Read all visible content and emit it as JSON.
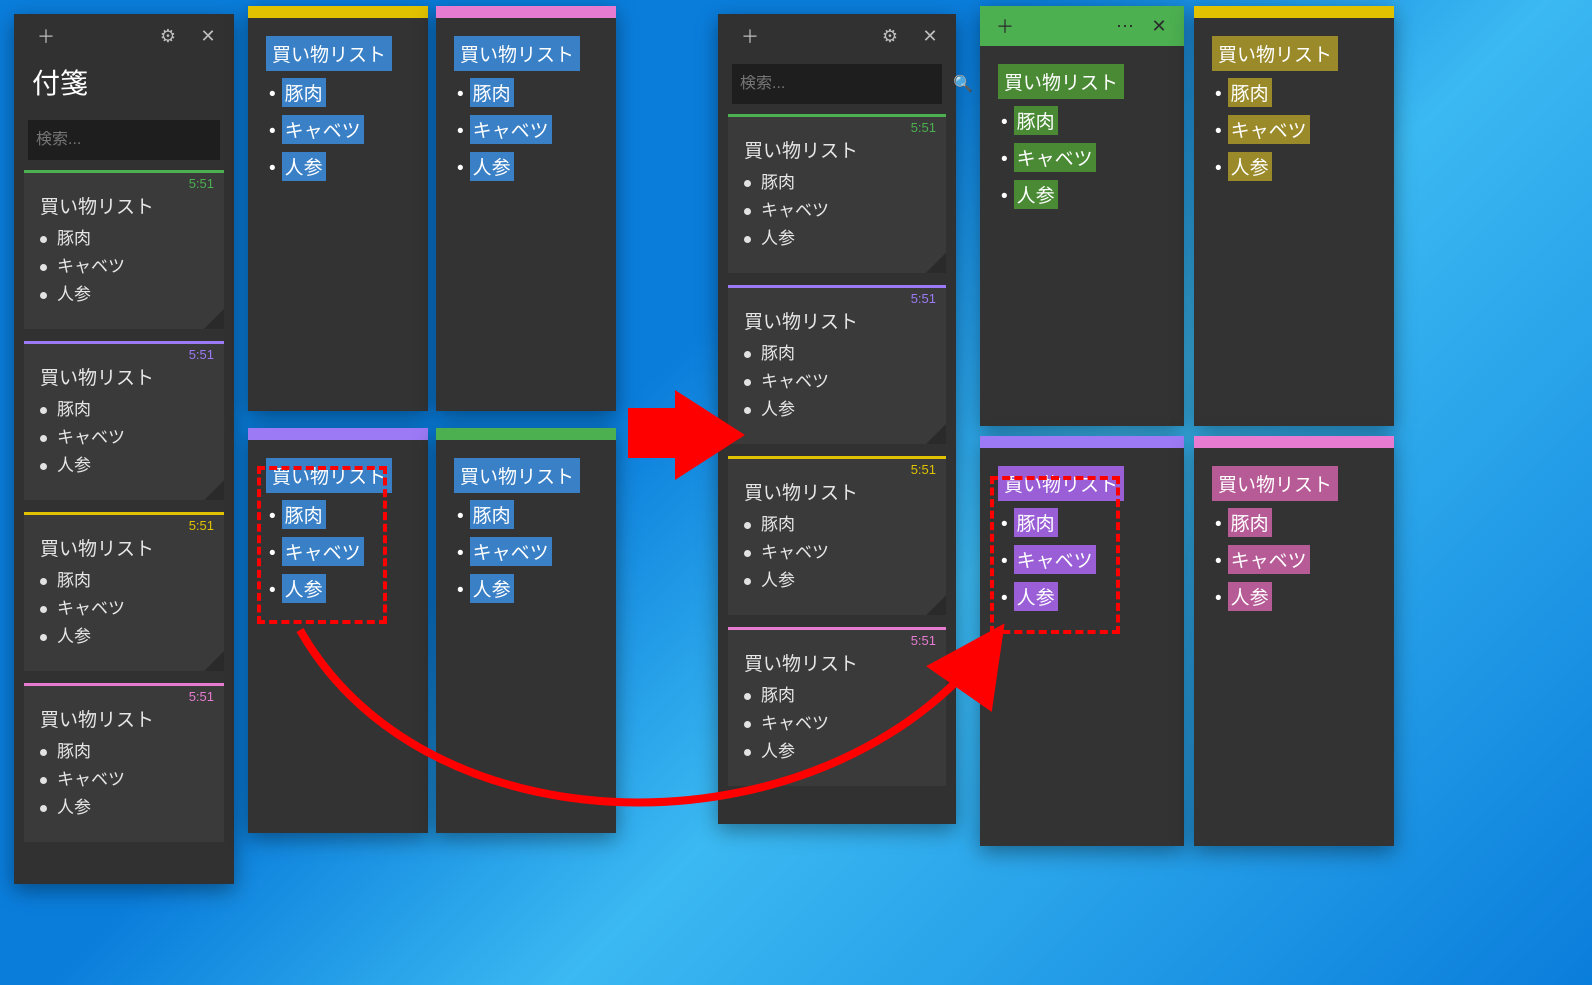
{
  "app_title": "付箋",
  "search_placeholder": "検索...",
  "time_label": "5:51",
  "note_title": "買い物リスト",
  "note_items": [
    "豚肉",
    "キャベツ",
    "人参"
  ],
  "colors": {
    "green": "#4caf50",
    "purple": "#9c7af6",
    "yellow": "#e0c200",
    "pink": "#e67bd1",
    "blue_hl": "#3a80c6",
    "green_hl": "#4a8a35",
    "olive_hl": "#9a8a2a",
    "purple_hl": "#9a5fd6",
    "mauve_hl": "#b75b96"
  },
  "left_panel_notes": [
    {
      "color": "green",
      "time_color": "#4caf50"
    },
    {
      "color": "purple",
      "time_color": "#9c7af6"
    },
    {
      "color": "yellow",
      "time_color": "#e0c200"
    },
    {
      "color": "pink",
      "time_color": "#e67bd1"
    }
  ],
  "right_panel_notes": [
    {
      "color": "green",
      "time_color": "#4caf50"
    },
    {
      "color": "purple",
      "time_color": "#9c7af6"
    },
    {
      "color": "yellow",
      "time_color": "#e0c200"
    },
    {
      "color": "pink",
      "time_color": "#e67bd1"
    }
  ]
}
